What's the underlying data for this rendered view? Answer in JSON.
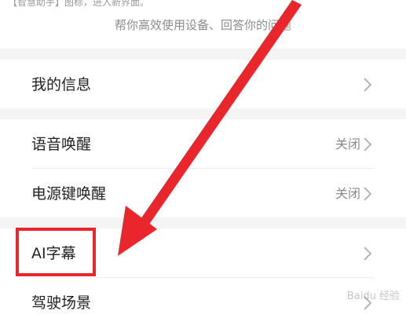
{
  "top_caption": "【智慧助手】图标，进入新界面。",
  "subtitle": "帮你高效使用设备、回答你的问题",
  "rows": [
    {
      "label": "我的信息",
      "value": ""
    },
    {
      "label": "语音唤醒",
      "value": "关闭"
    },
    {
      "label": "电源键唤醒",
      "value": "关闭"
    },
    {
      "label": "AI字幕",
      "value": ""
    },
    {
      "label": "驾驶场景",
      "value": ""
    }
  ],
  "watermark": "Baidu 经验",
  "colors": {
    "annotation_red": "#e8262c",
    "section_gap": "#f4f4f4",
    "label_text": "#222222",
    "secondary_text": "#8a8a8a"
  },
  "icons": [
    "chevron-right-icon"
  ]
}
